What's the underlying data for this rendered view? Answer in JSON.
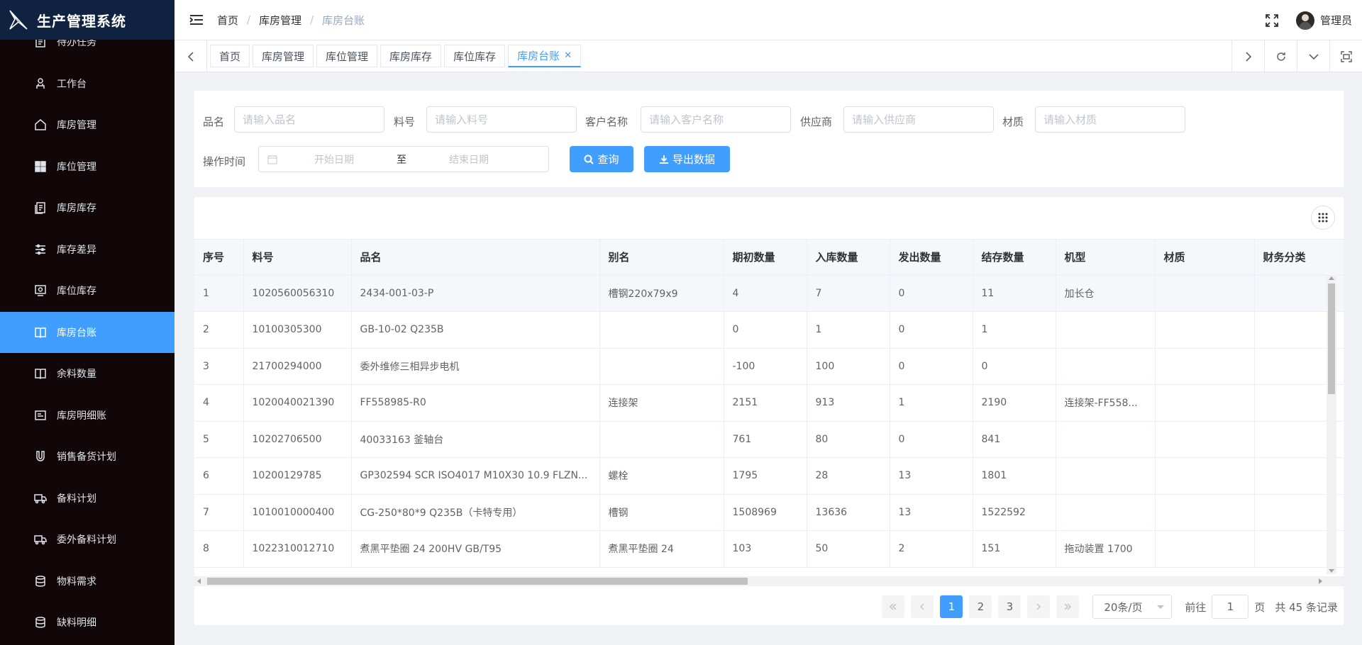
{
  "app": {
    "title": "生产管理系统"
  },
  "sidebar": {
    "items": [
      {
        "label": "待办任务",
        "icon": "clipboard-icon",
        "active": false
      },
      {
        "label": "工作台",
        "icon": "workbench-icon",
        "active": false
      },
      {
        "label": "库房管理",
        "icon": "home-icon",
        "active": false
      },
      {
        "label": "库位管理",
        "icon": "grid-icon",
        "active": false
      },
      {
        "label": "库房库存",
        "icon": "document-list-icon",
        "active": false
      },
      {
        "label": "库存差异",
        "icon": "sliders-icon",
        "active": false
      },
      {
        "label": "库位库存",
        "icon": "monitor-icon",
        "active": false
      },
      {
        "label": "库房台账",
        "icon": "book-icon",
        "active": true
      },
      {
        "label": "余料数量",
        "icon": "book-icon",
        "active": false
      },
      {
        "label": "库房明细账",
        "icon": "card-icon",
        "active": false
      },
      {
        "label": "销售备货计划",
        "icon": "magnet-icon",
        "active": false
      },
      {
        "label": "备料计划",
        "icon": "truck-icon",
        "active": false
      },
      {
        "label": "委外备料计划",
        "icon": "truck-icon",
        "active": false
      },
      {
        "label": "物料需求",
        "icon": "database-icon",
        "active": false
      },
      {
        "label": "缺料明细",
        "icon": "database-icon",
        "active": false
      }
    ]
  },
  "header": {
    "breadcrumb": [
      "首页",
      "库房管理",
      "库房台账"
    ],
    "username": "管理员"
  },
  "tabs": [
    {
      "label": "首页",
      "active": false
    },
    {
      "label": "库房管理",
      "active": false
    },
    {
      "label": "库位管理",
      "active": false
    },
    {
      "label": "库房库存",
      "active": false
    },
    {
      "label": "库位库存",
      "active": false
    },
    {
      "label": "库房台账",
      "active": true
    }
  ],
  "search": {
    "name_label": "品名",
    "name_placeholder": "请输入品名",
    "code_label": "料号",
    "code_placeholder": "请输入料号",
    "customer_label": "客户名称",
    "customer_placeholder": "请输入客户名称",
    "supplier_label": "供应商",
    "supplier_placeholder": "请输入供应商",
    "material_label": "材质",
    "material_placeholder": "请输入材质",
    "time_label": "操作时间",
    "start_placeholder": "开始日期",
    "range_sep": "至",
    "end_placeholder": "结束日期",
    "query_label": "查询",
    "export_label": "导出数据"
  },
  "table": {
    "columns": [
      "序号",
      "料号",
      "品名",
      "别名",
      "期初数量",
      "入库数量",
      "发出数量",
      "结存数量",
      "机型",
      "材质",
      "财务分类"
    ],
    "rows": [
      [
        "1",
        "1020560056310",
        "2434-001-03-P",
        "槽钢220x79x9",
        "4",
        "7",
        "0",
        "11",
        "加长仓",
        "",
        ""
      ],
      [
        "2",
        "10100305300",
        "GB-10-02 Q235B",
        "",
        "0",
        "1",
        "0",
        "1",
        "",
        "",
        ""
      ],
      [
        "3",
        "21700294000",
        "委外维修三相异步电机",
        "",
        "-100",
        "100",
        "0",
        "0",
        "",
        "",
        ""
      ],
      [
        "4",
        "1020040021390",
        "FF558985-R0",
        "连接架",
        "2151",
        "913",
        "1",
        "2190",
        "连接架-FF558...",
        "",
        ""
      ],
      [
        "5",
        "10202706500",
        "40033163 釜轴台",
        "",
        "761",
        "80",
        "0",
        "841",
        "",
        "",
        ""
      ],
      [
        "6",
        "10200129785",
        "GP302594 SCR ISO4017 M10X30 10.9 FLZN...",
        "螺栓",
        "1795",
        "28",
        "13",
        "1801",
        "",
        "",
        ""
      ],
      [
        "7",
        "1010010000400",
        "CG-250*80*9 Q235B（卡特专用）",
        "槽钢",
        "1508969",
        "13636",
        "13",
        "1522592",
        "",
        "",
        ""
      ],
      [
        "8",
        "1022310012710",
        "煮黑平垫圈 24 200HV GB/T95",
        "煮黑平垫圈 24",
        "103",
        "50",
        "2",
        "151",
        "拖动装置 1700",
        "",
        ""
      ]
    ]
  },
  "pagination": {
    "pages": [
      "1",
      "2",
      "3"
    ],
    "current": "1",
    "page_size": "20条/页",
    "goto_prefix": "前往",
    "goto_value": "1",
    "goto_suffix": "页",
    "total": "共 45 条记录"
  },
  "colors": {
    "primary": "#409eff",
    "sidebar_bg": "#120708",
    "logo_bg": "#0f2340"
  }
}
